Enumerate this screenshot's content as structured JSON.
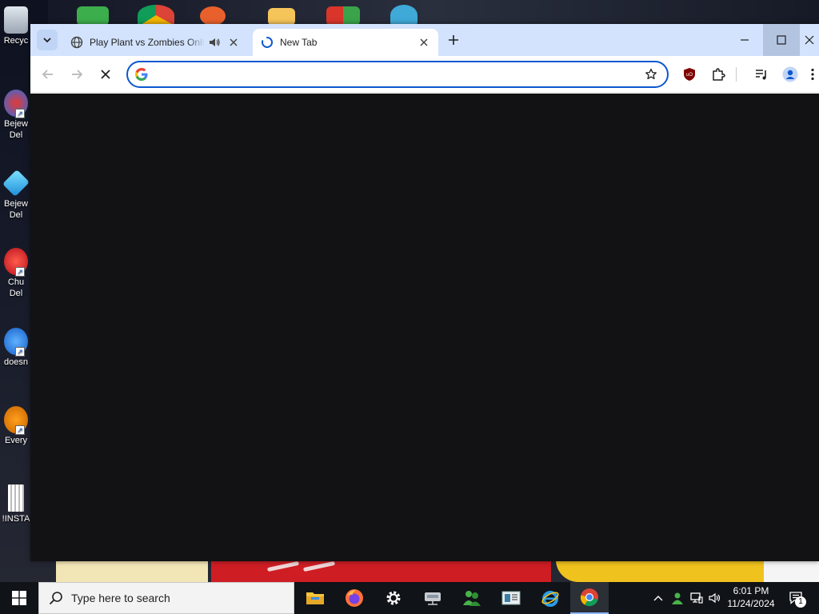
{
  "desktop": {
    "icons": [
      {
        "label": "Recyc",
        "icon": "recycle-bin-icon"
      },
      {
        "label": "Bejew",
        "label2": "Del",
        "icon": "bejeweled-icon"
      },
      {
        "label": "Bejew",
        "label2": "Del",
        "icon": "bejeweled-gem-icon"
      },
      {
        "label": "Chu",
        "label2": "Del",
        "icon": "chuzzle-icon"
      },
      {
        "label": "doesn",
        "icon": "app-shortcut-icon"
      },
      {
        "label": "Every",
        "icon": "everything-icon"
      },
      {
        "label": "!INSTA",
        "icon": "document-icon"
      }
    ]
  },
  "browser": {
    "tabs": [
      {
        "title": "Play Plant vs Zombies Online",
        "state": "inactive",
        "audio": true
      },
      {
        "title": "New Tab",
        "state": "active",
        "loading": true
      }
    ],
    "omnibox": {
      "value": "",
      "placeholder": ""
    },
    "colors": {
      "tabstrip": "#d3e3fd",
      "content_bg": "#121214",
      "omnibox_border": "#0b57d0"
    }
  },
  "taskbar": {
    "search_placeholder": "Type here to search",
    "apps": [
      "file-explorer-icon",
      "firefox-icon",
      "settings-icon",
      "network-drive-icon",
      "users-icon",
      "news-icon",
      "internet-explorer-icon",
      "chrome-icon"
    ],
    "clock": {
      "time": "6:01 PM",
      "date": "11/24/2024"
    },
    "notification_count": "1"
  }
}
